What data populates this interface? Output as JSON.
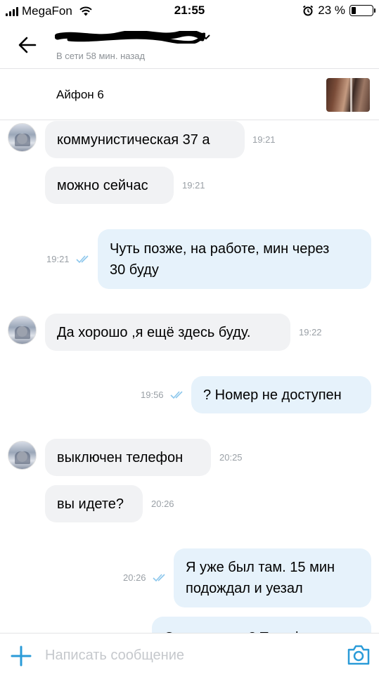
{
  "status_bar": {
    "carrier": "MegaFon",
    "time": "21:55",
    "battery": "23 %",
    "battery_level_percent": 23
  },
  "header": {
    "back_icon": "arrow-left-icon",
    "presence": "В сети 58 мин. назад"
  },
  "product": {
    "title": "Айфон 6"
  },
  "messages": [
    {
      "dir": "in",
      "lines": [
        "коммунистическая 37 а"
      ],
      "time": "19:21"
    },
    {
      "dir": "in",
      "lines": [
        "можно сейчас"
      ],
      "time": "19:21"
    },
    {
      "dir": "out",
      "lines": [
        "Чуть позже, на работе, мин через",
        "30 буду"
      ],
      "time": "19:21"
    },
    {
      "dir": "in",
      "lines": [
        "Да хорошо ,я ещё здесь буду."
      ],
      "time": "19:22"
    },
    {
      "dir": "out",
      "lines": [
        "? Номер не доступен"
      ],
      "time": "19:56"
    },
    {
      "dir": "in",
      "lines": [
        "выключен телефон"
      ],
      "time": "20:25"
    },
    {
      "dir": "in",
      "lines": [
        "вы идете?"
      ],
      "time": "20:26"
    },
    {
      "dir": "out",
      "lines": [
        "Я уже был там. 15 мин",
        "подождал и уезал"
      ],
      "time": "20:26"
    },
    {
      "dir": "out",
      "lines": [
        "Снова ехать ? Телефон не"
      ],
      "time": ""
    }
  ],
  "composer": {
    "placeholder": "Написать сообщение",
    "attach_icon": "plus-icon",
    "camera_icon": "camera-icon"
  },
  "colors": {
    "accent": "#2a9bd8",
    "incoming_bubble": "#f1f2f4",
    "outgoing_bubble": "#e6f2fb",
    "time_text": "#9aa0a6"
  }
}
